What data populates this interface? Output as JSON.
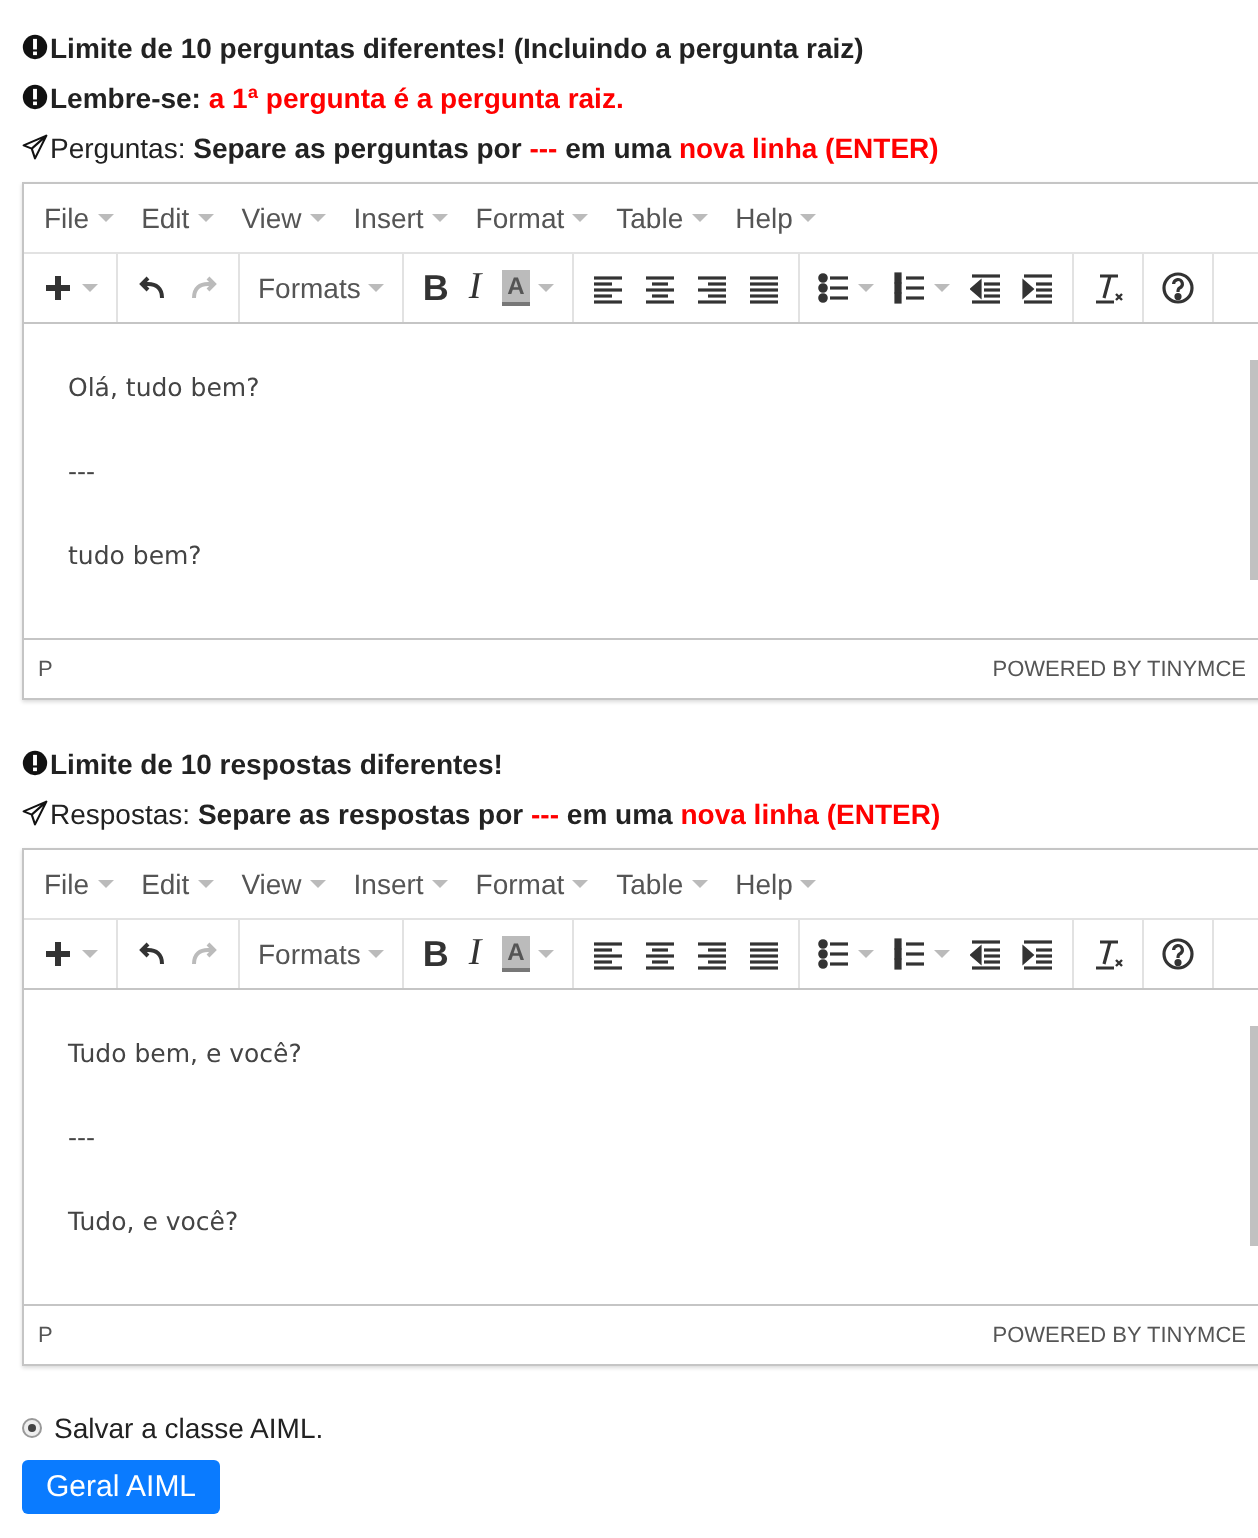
{
  "sections": [
    {
      "notes": [
        {
          "text": "Limite de 10 perguntas diferentes! (Incluindo a pergunta raiz)"
        },
        {
          "text": "Lembre-se:",
          "highlight": "a 1ª pergunta é a pergunta raiz."
        },
        {
          "label": "Perguntas:",
          "text": "Separe as perguntas por",
          "separator": "---",
          "middle": "em uma",
          "highlight": "nova linha (ENTER)"
        }
      ],
      "editor": {
        "menus": [
          "File",
          "Edit",
          "View",
          "Insert",
          "Format",
          "Table",
          "Help"
        ],
        "toolbar": [
          [
            {
              "kind": "plus",
              "dropdown": true,
              "disabled": false
            }
          ],
          [
            {
              "kind": "undo",
              "dropdown": false,
              "disabled": false
            },
            {
              "kind": "redo",
              "dropdown": false,
              "disabled": true
            }
          ],
          [
            {
              "kind": "formats",
              "label": "Formats",
              "dropdown": true,
              "disabled": false
            }
          ],
          [
            {
              "kind": "bold",
              "label": "B",
              "dropdown": false,
              "disabled": false
            },
            {
              "kind": "italic",
              "label": "I",
              "dropdown": false,
              "disabled": false
            },
            {
              "kind": "color",
              "label": "A",
              "dropdown": true,
              "disabled": false
            }
          ],
          [
            {
              "kind": "align-left",
              "dropdown": false,
              "disabled": false
            },
            {
              "kind": "align-center",
              "dropdown": false,
              "disabled": false
            },
            {
              "kind": "align-right",
              "dropdown": false,
              "disabled": false
            },
            {
              "kind": "justify",
              "dropdown": false,
              "disabled": false
            }
          ],
          [
            {
              "kind": "bullets",
              "dropdown": true,
              "disabled": false
            },
            {
              "kind": "numbers",
              "dropdown": true,
              "disabled": false
            },
            {
              "kind": "outdent",
              "dropdown": false,
              "disabled": false
            },
            {
              "kind": "indent",
              "dropdown": false,
              "disabled": false
            }
          ],
          [
            {
              "kind": "clear",
              "dropdown": false,
              "disabled": false
            }
          ],
          [
            {
              "kind": "help",
              "dropdown": false,
              "disabled": false
            }
          ]
        ],
        "content": [
          "Olá, tudo bem?",
          "---",
          "tudo bem?"
        ],
        "path": "P",
        "powered": "POWERED BY TINYMCE"
      }
    },
    {
      "notes": [
        {
          "text": "Limite de 10 respostas diferentes!"
        },
        {
          "label": "Respostas:",
          "text": "Separe as respostas por",
          "separator": "---",
          "middle": "em uma",
          "highlight": "nova linha (ENTER)"
        }
      ],
      "editor": {
        "menus": [
          "File",
          "Edit",
          "View",
          "Insert",
          "Format",
          "Table",
          "Help"
        ],
        "toolbar": [
          [
            {
              "kind": "plus",
              "dropdown": true,
              "disabled": false
            }
          ],
          [
            {
              "kind": "undo",
              "dropdown": false,
              "disabled": false
            },
            {
              "kind": "redo",
              "dropdown": false,
              "disabled": true
            }
          ],
          [
            {
              "kind": "formats",
              "label": "Formats",
              "dropdown": true,
              "disabled": false
            }
          ],
          [
            {
              "kind": "bold",
              "label": "B",
              "dropdown": false,
              "disabled": false
            },
            {
              "kind": "italic",
              "label": "I",
              "dropdown": false,
              "disabled": false
            },
            {
              "kind": "color",
              "label": "A",
              "dropdown": true,
              "disabled": false
            }
          ],
          [
            {
              "kind": "align-left",
              "dropdown": false,
              "disabled": false
            },
            {
              "kind": "align-center",
              "dropdown": false,
              "disabled": false
            },
            {
              "kind": "align-right",
              "dropdown": false,
              "disabled": false
            },
            {
              "kind": "justify",
              "dropdown": false,
              "disabled": false
            }
          ],
          [
            {
              "kind": "bullets",
              "dropdown": true,
              "disabled": false
            },
            {
              "kind": "numbers",
              "dropdown": true,
              "disabled": false
            },
            {
              "kind": "outdent",
              "dropdown": false,
              "disabled": false
            },
            {
              "kind": "indent",
              "dropdown": false,
              "disabled": false
            }
          ],
          [
            {
              "kind": "clear",
              "dropdown": false,
              "disabled": false
            }
          ],
          [
            {
              "kind": "help",
              "dropdown": false,
              "disabled": false
            }
          ]
        ],
        "content": [
          "Tudo bem, e você?",
          "---",
          "Tudo, e você?"
        ],
        "path": "P",
        "powered": "POWERED BY TINYMCE"
      }
    }
  ],
  "option": {
    "label": "Salvar a classe AIML.",
    "checked": true
  },
  "button": "Geral AIML"
}
